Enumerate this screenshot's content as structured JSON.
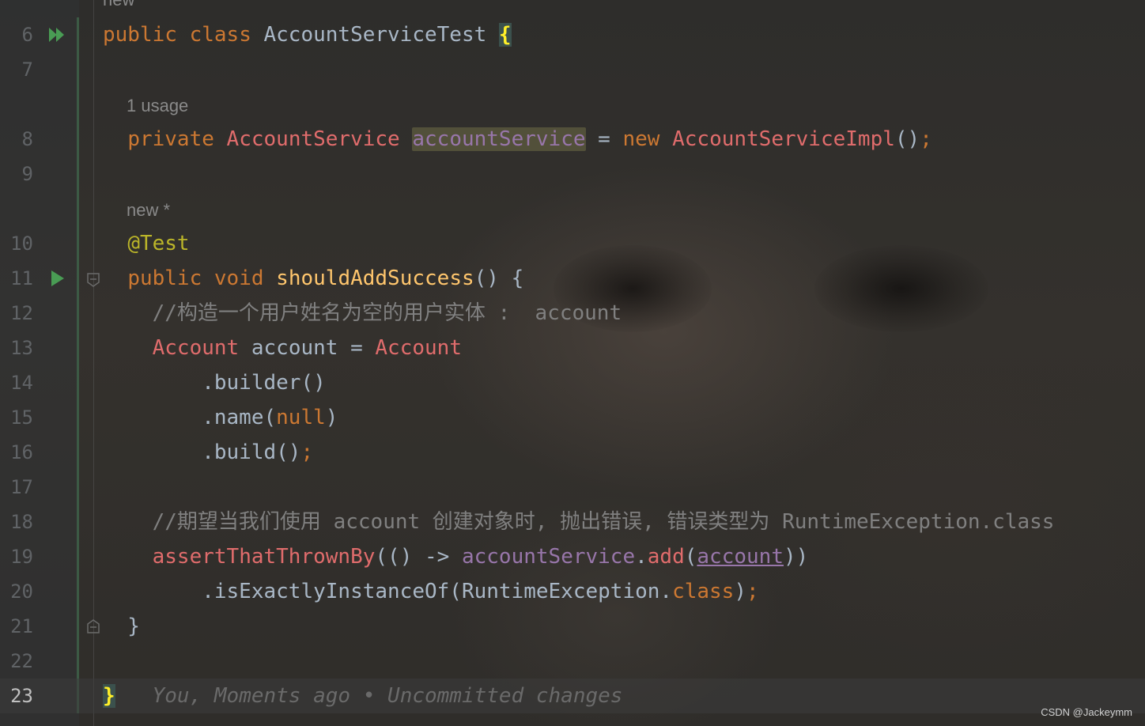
{
  "editor": {
    "hints": {
      "top_cut": "new *",
      "usages": "1 usage",
      "author_new": "new *"
    },
    "lines": [
      {
        "number": "6",
        "tokens": [
          {
            "t": "public ",
            "c": "kw"
          },
          {
            "t": "class ",
            "c": "kw"
          },
          {
            "t": "AccountServiceTest ",
            "c": ""
          },
          {
            "t": "{",
            "c": "brace-hl"
          }
        ]
      },
      {
        "number": "7",
        "tokens": []
      },
      {
        "number": "8",
        "tokens": [
          {
            "t": "  ",
            "c": ""
          },
          {
            "t": "private ",
            "c": "kw"
          },
          {
            "t": "AccountService ",
            "c": "cls"
          },
          {
            "t": "accountService",
            "c": "fld field-hl"
          },
          {
            "t": " = ",
            "c": ""
          },
          {
            "t": "new ",
            "c": "kw"
          },
          {
            "t": "AccountServiceImpl",
            "c": "cls"
          },
          {
            "t": "()",
            "c": ""
          },
          {
            "t": ";",
            "c": "semi"
          }
        ]
      },
      {
        "number": "9",
        "tokens": []
      },
      {
        "number": "10",
        "tokens": [
          {
            "t": "  ",
            "c": ""
          },
          {
            "t": "@Test",
            "c": "ann"
          }
        ]
      },
      {
        "number": "11",
        "tokens": [
          {
            "t": "  ",
            "c": ""
          },
          {
            "t": "public ",
            "c": "kw"
          },
          {
            "t": "void ",
            "c": "kw"
          },
          {
            "t": "shouldAddSuccess",
            "c": "fn"
          },
          {
            "t": "() {",
            "c": ""
          }
        ]
      },
      {
        "number": "12",
        "tokens": [
          {
            "t": "    ",
            "c": ""
          },
          {
            "t": "//构造一个用户姓名为空的用户实体 :  account",
            "c": "cmt"
          }
        ]
      },
      {
        "number": "13",
        "tokens": [
          {
            "t": "    ",
            "c": ""
          },
          {
            "t": "Account ",
            "c": "cls"
          },
          {
            "t": "account = ",
            "c": ""
          },
          {
            "t": "Account",
            "c": "cls"
          }
        ]
      },
      {
        "number": "14",
        "tokens": [
          {
            "t": "        .builder()",
            "c": ""
          }
        ]
      },
      {
        "number": "15",
        "tokens": [
          {
            "t": "        .name(",
            "c": ""
          },
          {
            "t": "null",
            "c": "kw"
          },
          {
            "t": ")",
            "c": ""
          }
        ]
      },
      {
        "number": "16",
        "tokens": [
          {
            "t": "        .build()",
            "c": ""
          },
          {
            "t": ";",
            "c": "semi"
          }
        ]
      },
      {
        "number": "17",
        "tokens": []
      },
      {
        "number": "18",
        "tokens": [
          {
            "t": "    ",
            "c": ""
          },
          {
            "t": "//期望当我们使用 account 创建对象时, 抛出错误, 错误类型为 RuntimeException.class",
            "c": "cmt"
          }
        ]
      },
      {
        "number": "19",
        "tokens": [
          {
            "t": "    ",
            "c": ""
          },
          {
            "t": "assertThatThrownBy",
            "c": "cls"
          },
          {
            "t": "(() -> ",
            "c": ""
          },
          {
            "t": "accountService",
            "c": "fld"
          },
          {
            "t": ".",
            "c": ""
          },
          {
            "t": "add",
            "c": "cls"
          },
          {
            "t": "(",
            "c": ""
          },
          {
            "t": "account",
            "c": "fld underline"
          },
          {
            "t": "))",
            "c": ""
          }
        ]
      },
      {
        "number": "20",
        "tokens": [
          {
            "t": "        .isExactlyInstanceOf(RuntimeException.",
            "c": ""
          },
          {
            "t": "class",
            "c": "kw"
          },
          {
            "t": ")",
            "c": ""
          },
          {
            "t": ";",
            "c": "semi"
          }
        ]
      },
      {
        "number": "21",
        "tokens": [
          {
            "t": "  }",
            "c": ""
          }
        ]
      },
      {
        "number": "22",
        "tokens": []
      },
      {
        "number": "23",
        "tokens": [
          {
            "t": "}",
            "c": "brace-hl"
          },
          {
            "t": "   ",
            "c": ""
          },
          {
            "t": "You, Moments ago • Uncommitted changes",
            "c": "blame"
          }
        ]
      }
    ]
  },
  "watermark": "CSDN @Jackeymm",
  "colors": {
    "keyword": "#cc7832",
    "class": "#e06c6c",
    "method": "#ffc66d",
    "field": "#9876aa",
    "annotation": "#bbb529",
    "comment": "#808080",
    "text": "#a9b7c6",
    "run_icon": "#499c54"
  },
  "icons": [
    "run-class-icon",
    "run-test-icon",
    "fold-start-icon",
    "fold-end-icon"
  ]
}
